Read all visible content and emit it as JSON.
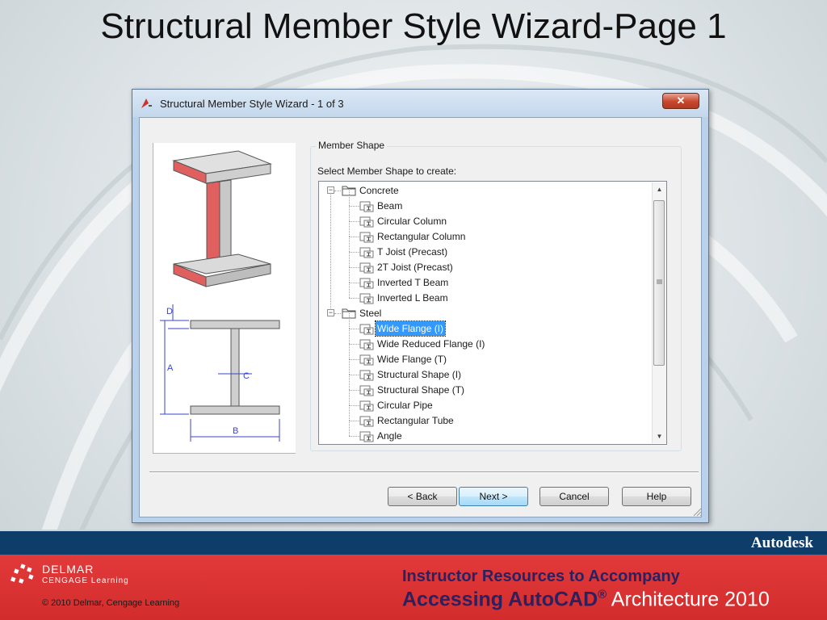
{
  "slide": {
    "title": "Structural Member Style Wizard-Page 1"
  },
  "dialog": {
    "title": "Structural Member Style Wizard - 1 of 3",
    "close_icon": "close-x-icon",
    "group_label": "Member Shape",
    "prompt": "Select Member Shape to create:",
    "diagram_labels": {
      "d": "D",
      "a": "A",
      "c": "C",
      "b": "B"
    },
    "tree": [
      {
        "label": "Concrete",
        "type": "folder",
        "expanded": true,
        "icon": "folder-icon"
      },
      {
        "label": "Beam",
        "type": "member",
        "icon": "member-shape-icon"
      },
      {
        "label": "Circular Column",
        "type": "member",
        "icon": "member-shape-icon"
      },
      {
        "label": "Rectangular Column",
        "type": "member",
        "icon": "member-shape-icon"
      },
      {
        "label": "T Joist (Precast)",
        "type": "member",
        "icon": "member-shape-icon"
      },
      {
        "label": "2T Joist (Precast)",
        "type": "member",
        "icon": "member-shape-icon"
      },
      {
        "label": "Inverted T Beam",
        "type": "member",
        "icon": "member-shape-icon"
      },
      {
        "label": "Inverted L Beam",
        "type": "member",
        "icon": "member-shape-icon"
      },
      {
        "label": "Steel",
        "type": "folder",
        "expanded": true,
        "icon": "folder-icon"
      },
      {
        "label": "Wide Flange (I)",
        "type": "member",
        "selected": true,
        "icon": "member-shape-icon"
      },
      {
        "label": "Wide Reduced Flange (I)",
        "type": "member",
        "icon": "member-shape-icon"
      },
      {
        "label": "Wide Flange (T)",
        "type": "member",
        "icon": "member-shape-icon"
      },
      {
        "label": "Structural Shape (I)",
        "type": "member",
        "icon": "member-shape-icon"
      },
      {
        "label": "Structural Shape (T)",
        "type": "member",
        "icon": "member-shape-icon"
      },
      {
        "label": "Circular Pipe",
        "type": "member",
        "icon": "member-shape-icon"
      },
      {
        "label": "Rectangular Tube",
        "type": "member",
        "icon": "member-shape-icon"
      },
      {
        "label": "Angle",
        "type": "member",
        "icon": "member-shape-icon"
      }
    ],
    "buttons": {
      "back": "< Back",
      "next": "Next >",
      "cancel": "Cancel",
      "help": "Help"
    },
    "colors": {
      "selection": "#3399ff",
      "flange_red": "#e05050"
    }
  },
  "footer": {
    "brand": "Autodesk",
    "publisher": "DELMAR",
    "publisher_sub": "CENGAGE Learning",
    "copyright": "© 2010 Delmar, Cengage Learning",
    "line1": "Instructor Resources to Accompany",
    "line2_bold": "Accessing AutoCAD",
    "line2_reg": "®",
    "line2_light": " Architecture 2010"
  }
}
